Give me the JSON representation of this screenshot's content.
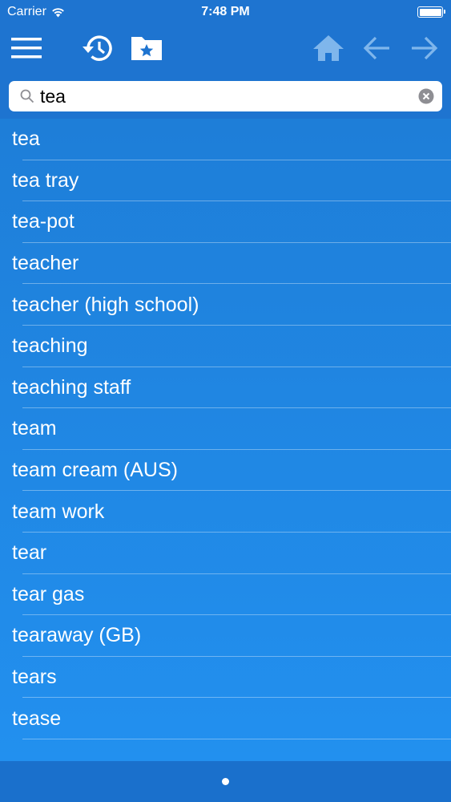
{
  "status_bar": {
    "carrier": "Carrier",
    "time": "7:48 PM"
  },
  "toolbar": {
    "icons": [
      "menu-icon",
      "history-icon",
      "favorites-folder-icon",
      "home-icon",
      "back-arrow-icon",
      "forward-arrow-icon"
    ],
    "icon_color": "#ffffff",
    "disabled_icon_color": "#7fb6ec"
  },
  "search": {
    "value": "tea",
    "placeholder": ""
  },
  "results": [
    "tea",
    "tea tray",
    "tea-pot",
    "teacher",
    "teacher (high school)",
    "teaching",
    "teaching staff",
    "team",
    "team cream (AUS)",
    "team work",
    "tear",
    "tear gas",
    "tearaway (GB)",
    "tears",
    "tease"
  ],
  "colors": {
    "bar": "#1e74d0",
    "list_top": "#1e7ed8",
    "list_bottom": "#2290ef",
    "text": "#ffffff"
  }
}
